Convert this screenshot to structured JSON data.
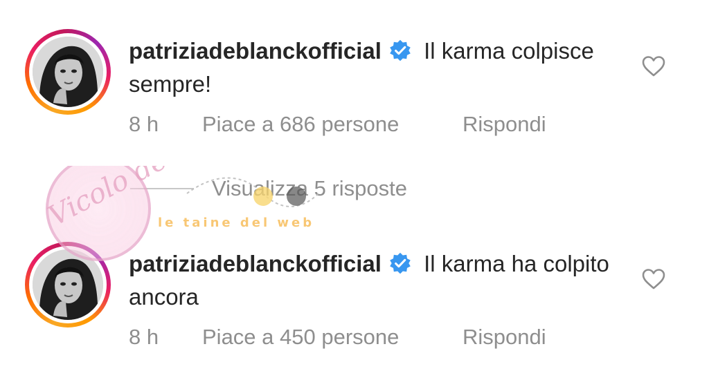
{
  "comments": [
    {
      "username": "patriziadeblanckofficial",
      "text": "Il karma colpisce sempre!",
      "time": "8 h",
      "likes": "Piace a 686 persone",
      "reply_label": "Rispondi"
    },
    {
      "username": "patriziadeblanckofficial",
      "text": "Il karma ha colpito ancora",
      "time": "8 h",
      "likes": "Piace a 450 persone",
      "reply_label": "Rispondi"
    }
  ],
  "view_replies": "Visualizza 5 risposte",
  "watermark": {
    "brand": "Vicolo delle News",
    "tagline": "le taine del web"
  },
  "icons": {
    "verified": "verified-badge-icon",
    "like": "heart-outline-icon"
  },
  "colors": {
    "verified": "#3897f0",
    "meta_text": "#8e8e8e",
    "ring_start": "#f9a825",
    "ring_end": "#c2185b"
  }
}
